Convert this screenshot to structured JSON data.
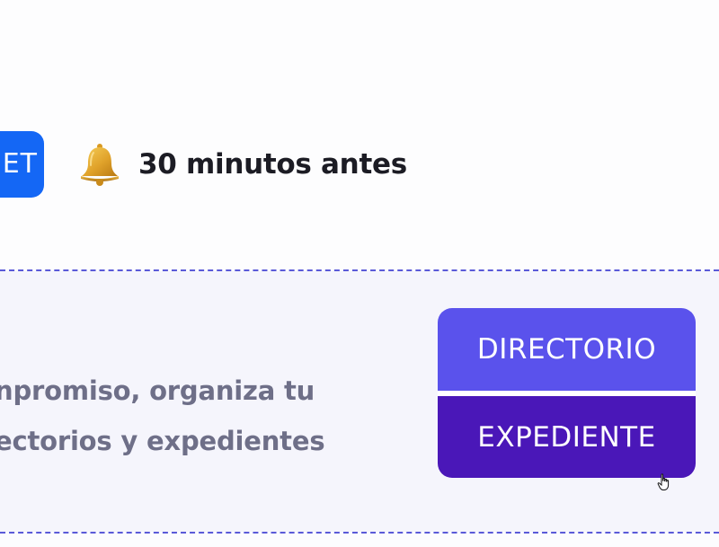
{
  "header": {
    "partial_button_label": "ET",
    "reminder_text": "30 minutos antes",
    "reminder_icon": "bell-icon"
  },
  "panel": {
    "description_line_1": "npromiso, organiza tu",
    "description_line_2": "ectorios y expedientes"
  },
  "actions": {
    "directorio_label": "DIRECTORIO",
    "expediente_label": "EXPEDIENTE"
  },
  "colors": {
    "accent_blue": "#1467f5",
    "directorio_purple": "#5a52ec",
    "expediente_purple": "#4a17b8",
    "dash_color": "#5a5ad8",
    "panel_bg": "#f5f5fc",
    "text_dark": "#1c1c24",
    "text_muted": "#6e6f88"
  }
}
